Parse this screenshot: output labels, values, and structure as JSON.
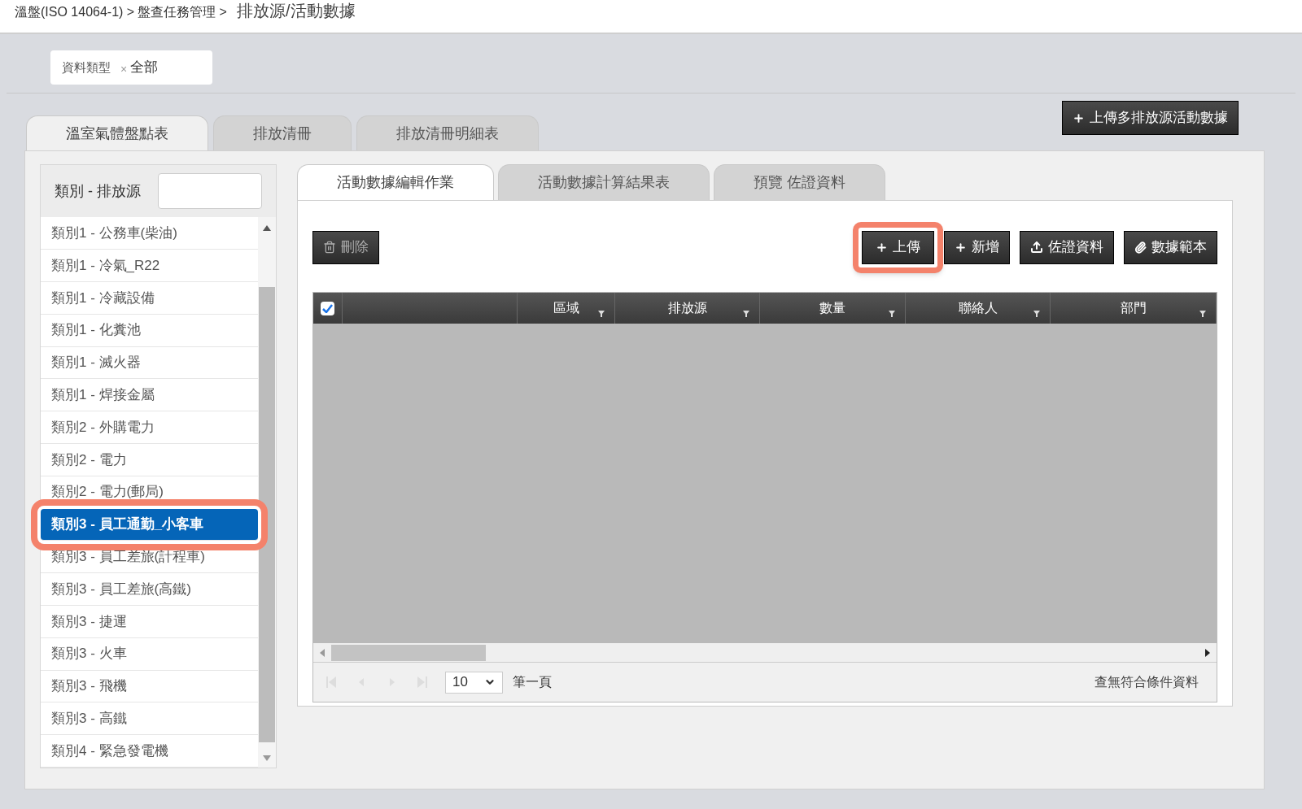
{
  "breadcrumb": {
    "items": [
      "溫盤(ISO 14064-1) >",
      "盤查任務管理 >"
    ],
    "current": "排放源/活動數據"
  },
  "filter": {
    "label": "資料類型",
    "remove": "×",
    "value": "全部"
  },
  "upload_multi_button": "上傳多排放源活動數據",
  "tabs": [
    {
      "label": "溫室氣體盤點表",
      "selected": true
    },
    {
      "label": "排放清冊",
      "selected": false
    },
    {
      "label": "排放清冊明細表",
      "selected": false
    }
  ],
  "sidebar": {
    "filter_label": "類別 - 排放源",
    "items": [
      {
        "label": "類別1 - 公務車(柴油)",
        "selected": false
      },
      {
        "label": "類別1 - 冷氣_R22",
        "selected": false
      },
      {
        "label": "類別1 - 冷藏設備",
        "selected": false
      },
      {
        "label": "類別1 - 化糞池",
        "selected": false
      },
      {
        "label": "類別1 - 滅火器",
        "selected": false
      },
      {
        "label": "類別1 - 焊接金屬",
        "selected": false
      },
      {
        "label": "類別2 - 外購電力",
        "selected": false
      },
      {
        "label": "類別2 - 電力",
        "selected": false
      },
      {
        "label": "類別2 - 電力(郵局)",
        "selected": false
      },
      {
        "label": "類別3 - 員工通勤_小客車",
        "selected": true
      },
      {
        "label": "類別3 - 員工差旅(計程車)",
        "selected": false
      },
      {
        "label": "類別3 - 員工差旅(高鐵)",
        "selected": false
      },
      {
        "label": "類別3 - 捷運",
        "selected": false
      },
      {
        "label": "類別3 - 火車",
        "selected": false
      },
      {
        "label": "類別3 - 飛機",
        "selected": false
      },
      {
        "label": "類別3 - 高鐵",
        "selected": false
      },
      {
        "label": "類別4 - 緊急發電機",
        "selected": false
      }
    ]
  },
  "inner_tabs": [
    {
      "label": "活動數據編輯作業",
      "selected": true
    },
    {
      "label": "活動數據計算結果表",
      "selected": false
    },
    {
      "label": "預覽 佐證資料",
      "selected": false
    }
  ],
  "toolbar": [
    {
      "kind": "delete",
      "label": "刪除",
      "disabled": true,
      "highlighted": false
    },
    {
      "kind": "upload",
      "label": "上傳",
      "disabled": false,
      "highlighted": true
    },
    {
      "kind": "add",
      "label": "新增",
      "disabled": false,
      "highlighted": false
    },
    {
      "kind": "evidence",
      "label": "佐證資料",
      "disabled": false,
      "highlighted": false
    },
    {
      "kind": "template",
      "label": "數據範本",
      "disabled": false,
      "highlighted": false
    }
  ],
  "grid": {
    "select_all_checked": true,
    "columns": [
      "區域",
      "排放源",
      "數量",
      "聯絡人",
      "部門"
    ]
  },
  "pager": {
    "page_size": "10",
    "page_size_label": "筆一頁",
    "message": "查無符合條件資料"
  }
}
